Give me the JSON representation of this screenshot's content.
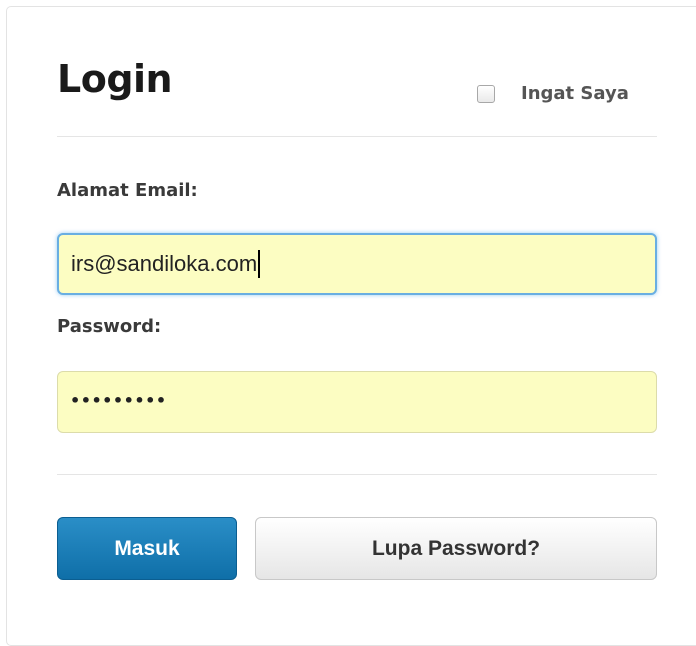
{
  "login": {
    "title": "Login",
    "remember_label": "Ingat Saya",
    "remember_checked": false,
    "email_label": "Alamat Email:",
    "email_value": "irs@sandiloka.com",
    "password_label": "Password:",
    "password_mask": "•••••••••",
    "submit_label": "Masuk",
    "forgot_label": "Lupa Password?"
  },
  "colors": {
    "primary_button": "#1a7db8",
    "autofill_field": "#fcfdc2",
    "focus_ring": "#69aee2"
  }
}
